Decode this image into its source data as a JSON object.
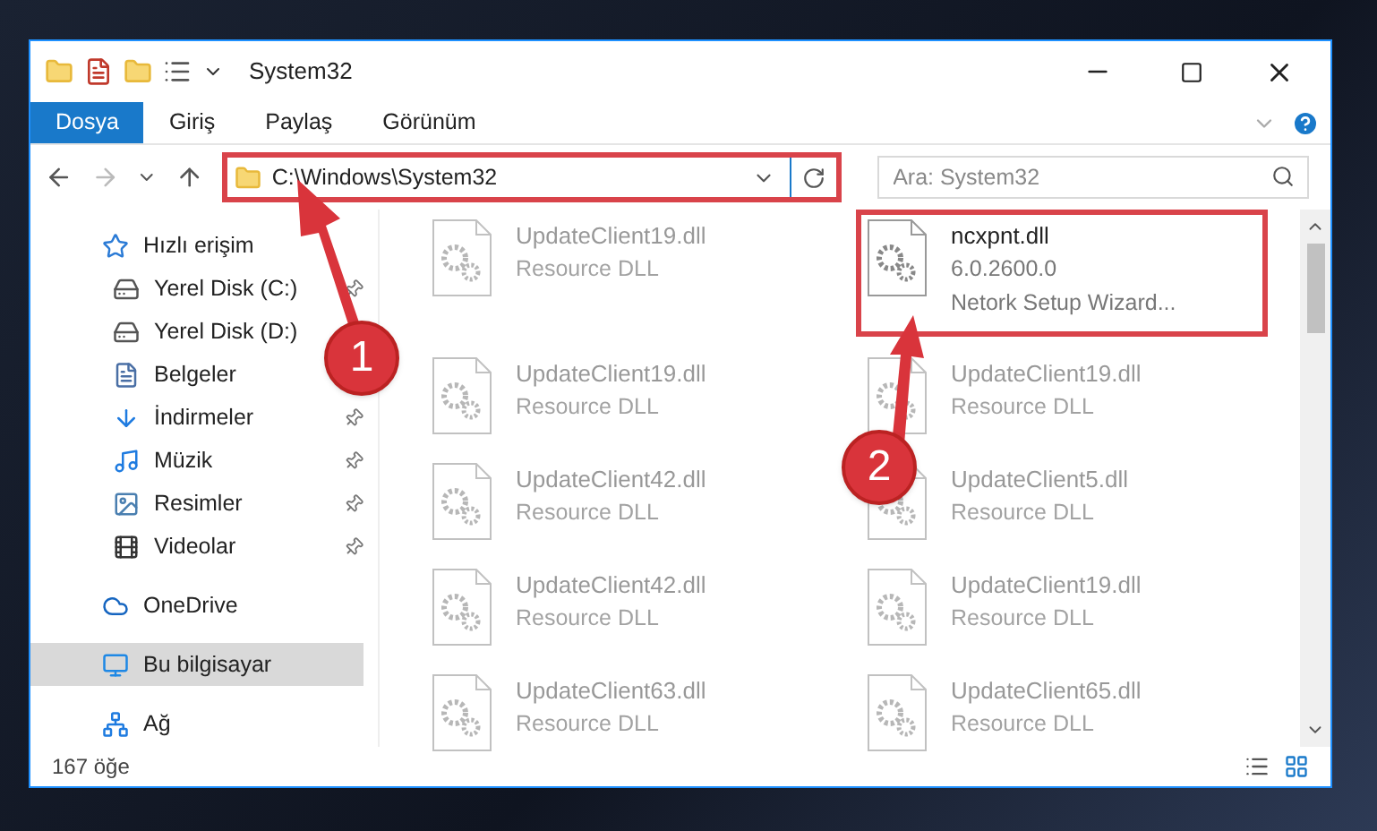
{
  "window": {
    "title": "System32"
  },
  "ribbon_tabs": [
    {
      "label": "Dosya",
      "selected": true
    },
    {
      "label": "Giriş",
      "selected": false
    },
    {
      "label": "Paylaş",
      "selected": false
    },
    {
      "label": "Görünüm",
      "selected": false
    }
  ],
  "address": {
    "path": "C:\\Windows\\System32",
    "highlighted": true
  },
  "search": {
    "placeholder": "Ara: System32"
  },
  "sidebar": {
    "items": [
      {
        "label": "Hızlı erişim",
        "kind": "star",
        "selected": false,
        "children": [
          {
            "label": "Yerel Disk (C:)",
            "kind": "drive",
            "pinned": true,
            "selected": false
          },
          {
            "label": "Yerel Disk (D:)",
            "kind": "drive",
            "selected": false
          },
          {
            "label": "Belgeler",
            "kind": "document",
            "selected": false
          },
          {
            "label": "İndirmeler",
            "kind": "download",
            "pinned": true,
            "selected": false
          },
          {
            "label": "Müzik",
            "kind": "music",
            "pinned": true,
            "selected": false
          },
          {
            "label": "Resimler",
            "kind": "picture",
            "pinned": true,
            "selected": false
          },
          {
            "label": "Videolar",
            "kind": "video",
            "pinned": true,
            "selected": false
          }
        ]
      },
      {
        "label": "OneDrive",
        "kind": "cloud",
        "selected": false
      },
      {
        "label": "Bu bilgisayar",
        "kind": "computer",
        "selected": true
      },
      {
        "label": "Ağ",
        "kind": "network",
        "selected": false
      }
    ]
  },
  "files": [
    {
      "name": "UpdateClient19.dll",
      "lines": [
        "Resource DLL"
      ],
      "blurred": true,
      "highlighted": false
    },
    {
      "name": "ncxpnt.dll",
      "lines": [
        "6.0.2600.0",
        "Netork Setup Wizard..."
      ],
      "blurred": false,
      "highlighted": true
    },
    {
      "name": "UpdateClient19.dll",
      "lines": [
        "Resource DLL"
      ],
      "blurred": true,
      "highlighted": false
    },
    {
      "name": "UpdateClient19.dll",
      "lines": [
        "Resource DLL"
      ],
      "blurred": true,
      "highlighted": false
    },
    {
      "name": "UpdateClient42.dll",
      "lines": [
        "Resource DLL"
      ],
      "blurred": true,
      "highlighted": false
    },
    {
      "name": "UpdateClient5.dll",
      "lines": [
        "Resource DLL"
      ],
      "blurred": true,
      "highlighted": false
    },
    {
      "name": "UpdateClient42.dll",
      "lines": [
        "Resource DLL"
      ],
      "blurred": true,
      "highlighted": false
    },
    {
      "name": "UpdateClient19.dll",
      "lines": [
        "Resource DLL"
      ],
      "blurred": true,
      "highlighted": false
    },
    {
      "name": "UpdateClient63.dll",
      "lines": [
        "Resource DLL"
      ],
      "blurred": true,
      "highlighted": false
    },
    {
      "name": "UpdateClient65.dll",
      "lines": [
        "Resource DLL"
      ],
      "blurred": true,
      "highlighted": false
    }
  ],
  "status_bar": {
    "count": "167 öğe"
  },
  "annotations": [
    {
      "number": "1"
    },
    {
      "number": "2"
    }
  ]
}
